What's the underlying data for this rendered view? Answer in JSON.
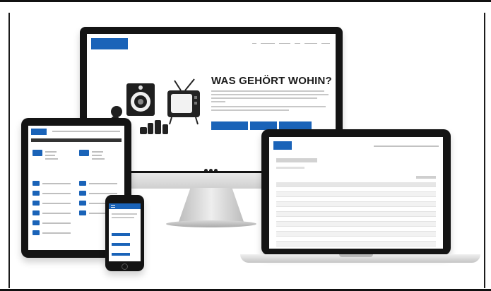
{
  "desktop": {
    "logo": "",
    "nav": [
      "",
      "",
      "",
      "",
      "",
      ""
    ],
    "heading": "WAS GEHÖRT WOHIN?",
    "buttons": [
      "",
      "",
      ""
    ]
  },
  "laptop": {
    "heading": "",
    "table_rows": 13
  },
  "colors": {
    "accent": "#1a63b8",
    "bezel": "#141414"
  }
}
